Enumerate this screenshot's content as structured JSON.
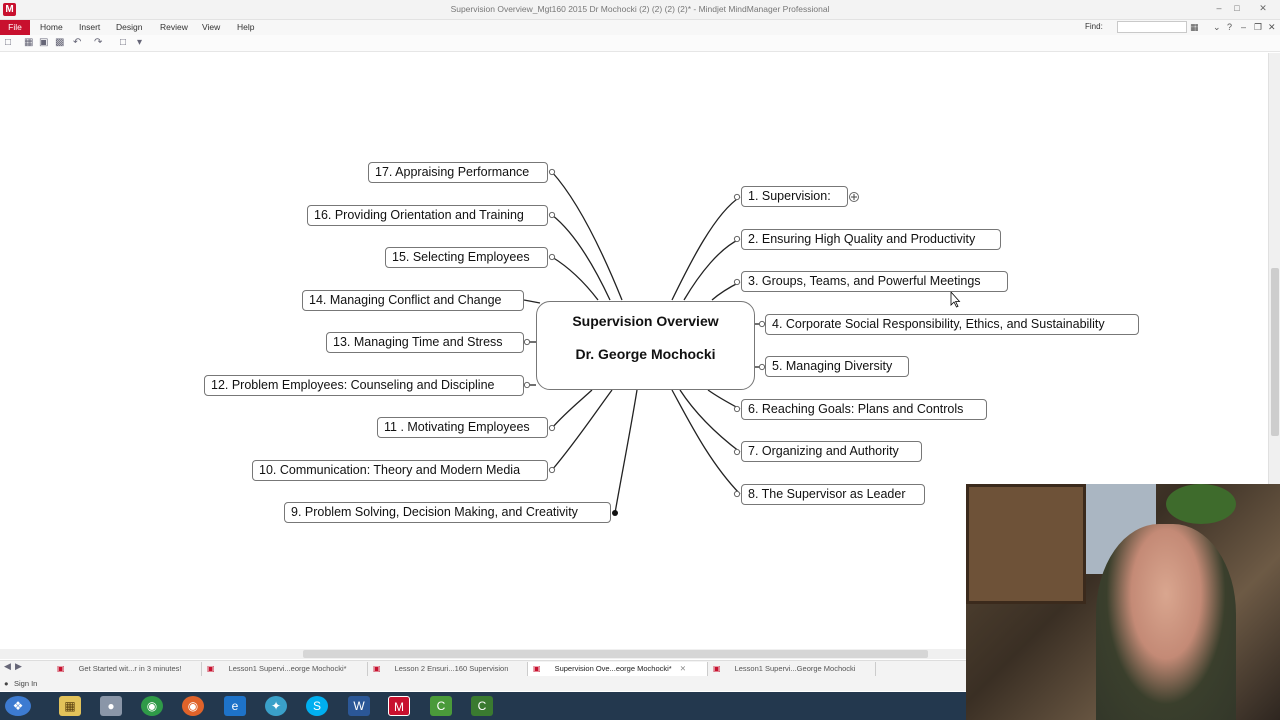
{
  "window": {
    "title": "Supervision Overview_Mgt160 2015 Dr Mochocki (2) (2) (2) (2)* - Mindjet MindManager Professional",
    "app_icon": "M",
    "controls": [
      "–",
      "□",
      "✕"
    ]
  },
  "menu": {
    "file": "File",
    "items": [
      "Home",
      "Insert",
      "Design",
      "Review",
      "View",
      "Help"
    ],
    "find_label": "Find:",
    "find_value": ""
  },
  "map": {
    "central": {
      "line1": "Supervision Overview",
      "line2": "Dr. George Mochocki"
    },
    "topics_right": [
      "1. Supervision:",
      "2. Ensuring High Quality and Productivity",
      "3. Groups, Teams, and Powerful Meetings",
      "4. Corporate Social Responsibility, Ethics, and Sustainability",
      "5. Managing Diversity",
      "6. Reaching Goals: Plans and Controls",
      "7. Organizing and Authority",
      "8. The Supervisor as Leader"
    ],
    "topics_left": [
      "9.  Problem Solving, Decision Making, and Creativity",
      "10. Communication: Theory and Modern Media",
      "11 . Motivating Employees",
      "12. Problem Employees: Counseling and Discipline",
      "13. Managing Time and Stress",
      "14. Managing Conflict and Change",
      "15. Selecting Employees",
      "16. Providing Orientation and Training",
      "17. Appraising Performance"
    ],
    "expand_symbol": "+"
  },
  "doc_tabs": [
    "Get Started wit...r in 3 minutes!",
    "Lesson1 Supervi...eorge Mochocki*",
    "Lesson 2 Ensuri...160 Supervision",
    "Supervision Ove...eorge Mochocki*",
    "Lesson1 Supervi...George Mochocki"
  ],
  "doc_tab_close": "✕",
  "status": {
    "sign_in": "Sign In"
  },
  "colors": {
    "brand": "#c8102e",
    "taskbar": "#23384e",
    "line": "#222222"
  }
}
